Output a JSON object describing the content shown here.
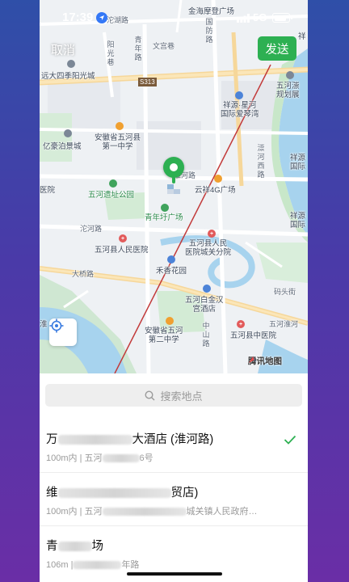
{
  "status_bar": {
    "time": "17:39",
    "network": "5G",
    "icons": [
      "location-arrow-icon",
      "signal-icon",
      "battery-icon"
    ]
  },
  "top_bar": {
    "cancel_label": "取消",
    "send_label": "发送",
    "send_color": "#2db052"
  },
  "map": {
    "labels": {
      "jinhai": "金海摩登广场",
      "tuohu": "沱湖路",
      "qingnian": "青年路",
      "wengong": "文宫巷",
      "guofang": "国防路",
      "xiang": "祥",
      "yangguang": "阳光巷",
      "yuanda": "远大四季阳光城",
      "s313": "S313",
      "xiangyuan": "祥源·星河\n国际爱琴湾",
      "wuhe_plan": "五河漴\n规划展",
      "anhui_1": "安徽省五河县\n第一中学",
      "yihao": "亿豪泊景城",
      "chong_west": "漴河西路",
      "xiangyuan_intl": "祥源\n国际",
      "huaihe": "淮河路",
      "yiyuan": "医院",
      "wuhe_yizhi": "五河遗址公园",
      "yunsheng": "云祥4G广场",
      "qingnian_plaza": "青年圩广场",
      "tuohe": "沱河路",
      "xiang2": "祥源\n国际",
      "wuhe_hospital": "五河县人民医院",
      "chengguan": "五河县人民\n医院城关分院",
      "daqiao": "大桥路",
      "hexiang": "禾香花园",
      "matou": "码头街",
      "baijin": "五河白金汉\n宫酒店",
      "anhui_2": "安徽省五河\n第二中学",
      "zhongshan": "中山路",
      "wuhe_tcm": "五河县中医院",
      "huai_right": "五河淮河",
      "hu": "淮"
    },
    "brand": "腾讯地图"
  },
  "search": {
    "placeholder": "搜索地点"
  },
  "results": [
    {
      "title_start": "万",
      "title_end": "大酒店 (淮河路)",
      "sub_start": "100m内 | 五河",
      "sub_end": "6号",
      "selected": true
    },
    {
      "title_start": "维",
      "title_end": "贸店)",
      "sub_start": "100m内 | 五河",
      "sub_end": "城关镇人民政府…",
      "selected": false
    },
    {
      "title_start": "青",
      "title_end": "场",
      "sub_start": "106m |",
      "sub_end": "年路",
      "selected": false
    }
  ]
}
